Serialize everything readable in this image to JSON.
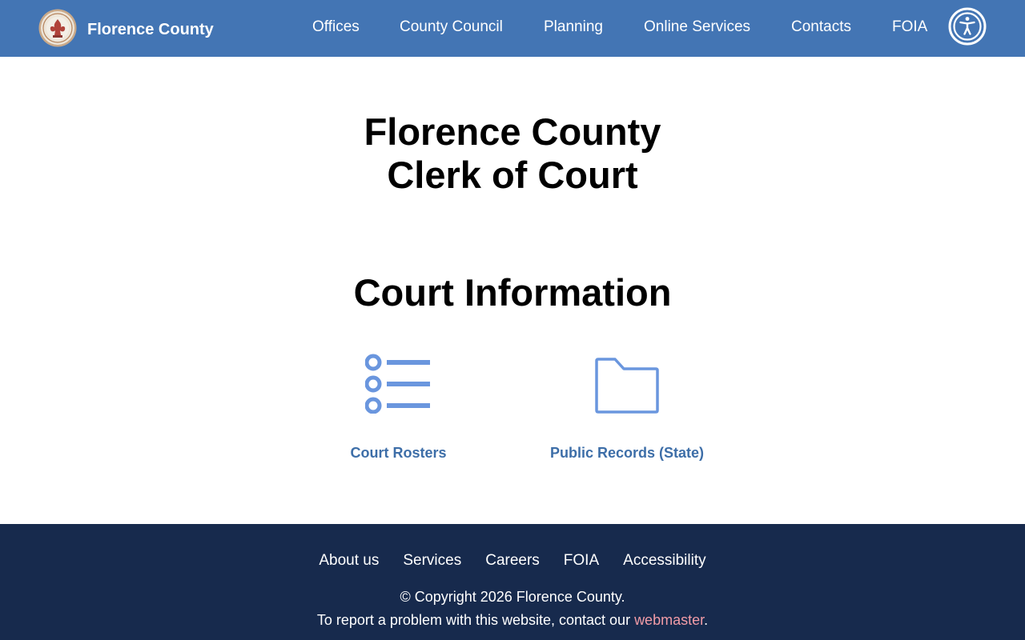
{
  "header": {
    "brand_name": "Florence County",
    "nav": [
      {
        "label": "Offices"
      },
      {
        "label": "County Council"
      },
      {
        "label": "Planning"
      },
      {
        "label": "Online Services"
      },
      {
        "label": "Contacts"
      },
      {
        "label": "FOIA"
      }
    ],
    "accessibility_icon": "accessibility-icon",
    "seal_icon": "county-seal-icon"
  },
  "main": {
    "title_line1": "Florence County",
    "title_line2": "Clerk of Court",
    "section_title": "Court Information",
    "cards": [
      {
        "label": "Court Rosters",
        "icon": "list-icon"
      },
      {
        "label": "Public Records (State)",
        "icon": "folder-icon"
      }
    ]
  },
  "footer": {
    "links": [
      {
        "label": "About us"
      },
      {
        "label": "Services"
      },
      {
        "label": "Careers"
      },
      {
        "label": "FOIA"
      },
      {
        "label": "Accessibility"
      }
    ],
    "copyright": "© Copyright 2026 Florence County.",
    "report_prefix": "To report a problem with this website, contact our ",
    "webmaster_label": "webmaster",
    "report_suffix": "."
  },
  "colors": {
    "header_bg": "#4375b4",
    "footer_bg": "#172a4d",
    "link_blue": "#3d6ea8",
    "icon_blue": "#6a96de",
    "webmaster_pink": "#f29ca7"
  }
}
